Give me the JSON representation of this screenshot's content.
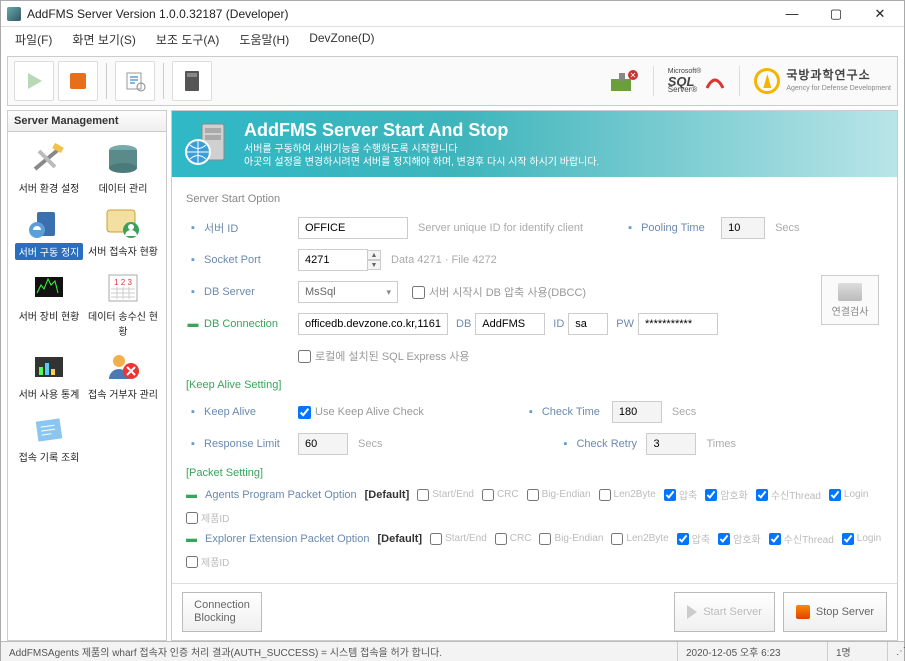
{
  "window": {
    "title": "AddFMS Server Version 1.0.0.32187 (Developer)"
  },
  "menus": {
    "file": "파일(F)",
    "view": "화면 보기(S)",
    "tools": "보조 도구(A)",
    "help": "도움말(H)",
    "devzone": "DevZone(D)"
  },
  "sidebar": {
    "title": "Server Management",
    "items": [
      {
        "label": "서버 환경 설정"
      },
      {
        "label": "데이터 관리"
      },
      {
        "label": "서버 구동 정지"
      },
      {
        "label": "서버 접속자 현황"
      },
      {
        "label": "서버 장비 현황"
      },
      {
        "label": "데이터 송수신 현황"
      },
      {
        "label": "서버 사용 통계"
      },
      {
        "label": "접속 거부자 관리"
      },
      {
        "label": "접속 기록 조회"
      }
    ]
  },
  "banner": {
    "title": "AddFMS Server Start And Stop",
    "line1": "서버를 구동하여 서버기능을 수행하도록 시작합니다",
    "line2": "아곳의 설정을 변경하시려면 서버를 정지해야 하며, 변경후 다시 시작 하시기 바랍니다."
  },
  "start_option": {
    "section_label": "Server Start Option",
    "server_id_label": "서버 ID",
    "server_id_value": "OFFICE",
    "server_id_hint": "Server unique ID for identify client",
    "pooling_label": "Pooling Time",
    "pooling_value": "10",
    "pooling_unit": "Secs",
    "socket_port_label": "Socket Port",
    "socket_port_value": "4271",
    "socket_port_hint": "Data 4271 · File 4272",
    "db_server_label": "DB Server",
    "db_server_value": "MsSql",
    "dbcc_label": "서버 시작시 DB 압축 사용(DBCC)",
    "db_conn_label": "DB Connection",
    "db_conn_host": "officedb.devzone.co.kr,1161",
    "db_label": "DB",
    "db_name": "AddFMS",
    "id_label": "ID",
    "id_value": "sa",
    "pw_label": "PW",
    "pw_value": "***********",
    "local_sql_label": "로컬에 설치된 SQL Express 사용",
    "conn_test_label": "연결검사"
  },
  "keep_alive": {
    "section_label": "[Keep Alive Setting]",
    "keep_alive_label": "Keep Alive",
    "use_keep_alive_label": "Use Keep Alive Check",
    "check_time_label": "Check Time",
    "check_time_value": "180",
    "check_time_unit": "Secs",
    "response_limit_label": "Response Limit",
    "response_limit_value": "60",
    "response_limit_unit": "Secs",
    "check_retry_label": "Check Retry",
    "check_retry_value": "3",
    "check_retry_unit": "Times"
  },
  "packet": {
    "section_label": "[Packet Setting]",
    "row1_label": "Agents Program Packet Option",
    "row2_label": "Explorer Extension Packet Option",
    "default_tag": "[Default]",
    "opts": {
      "start_end": "Start/End",
      "crc": "CRC",
      "big_endian": "Big-Endian",
      "len2byte": "Len2Byte",
      "compress": "압축",
      "encrypt": "암호화",
      "recv_thread": "수신Thread",
      "login": "Login",
      "product_id": "제품ID"
    }
  },
  "buttons": {
    "conn_blocking": "Connection Blocking",
    "start_server": "Start Server",
    "stop_server": "Stop Server"
  },
  "status": {
    "message": "AddFMSAgents 제품의 wharf 접속자 인증 처리 결과(AUTH_SUCCESS) = 시스템 접속을 허가 합니다.",
    "datetime": "2020-12-05 오후 6:23",
    "users": "1명"
  },
  "logos": {
    "sql_top": "Microsoft®",
    "sql_main": "SQL",
    "sql_sub": "Server®",
    "agency_main": "국방과학연구소",
    "agency_sub": "Agency for Defense Development"
  }
}
